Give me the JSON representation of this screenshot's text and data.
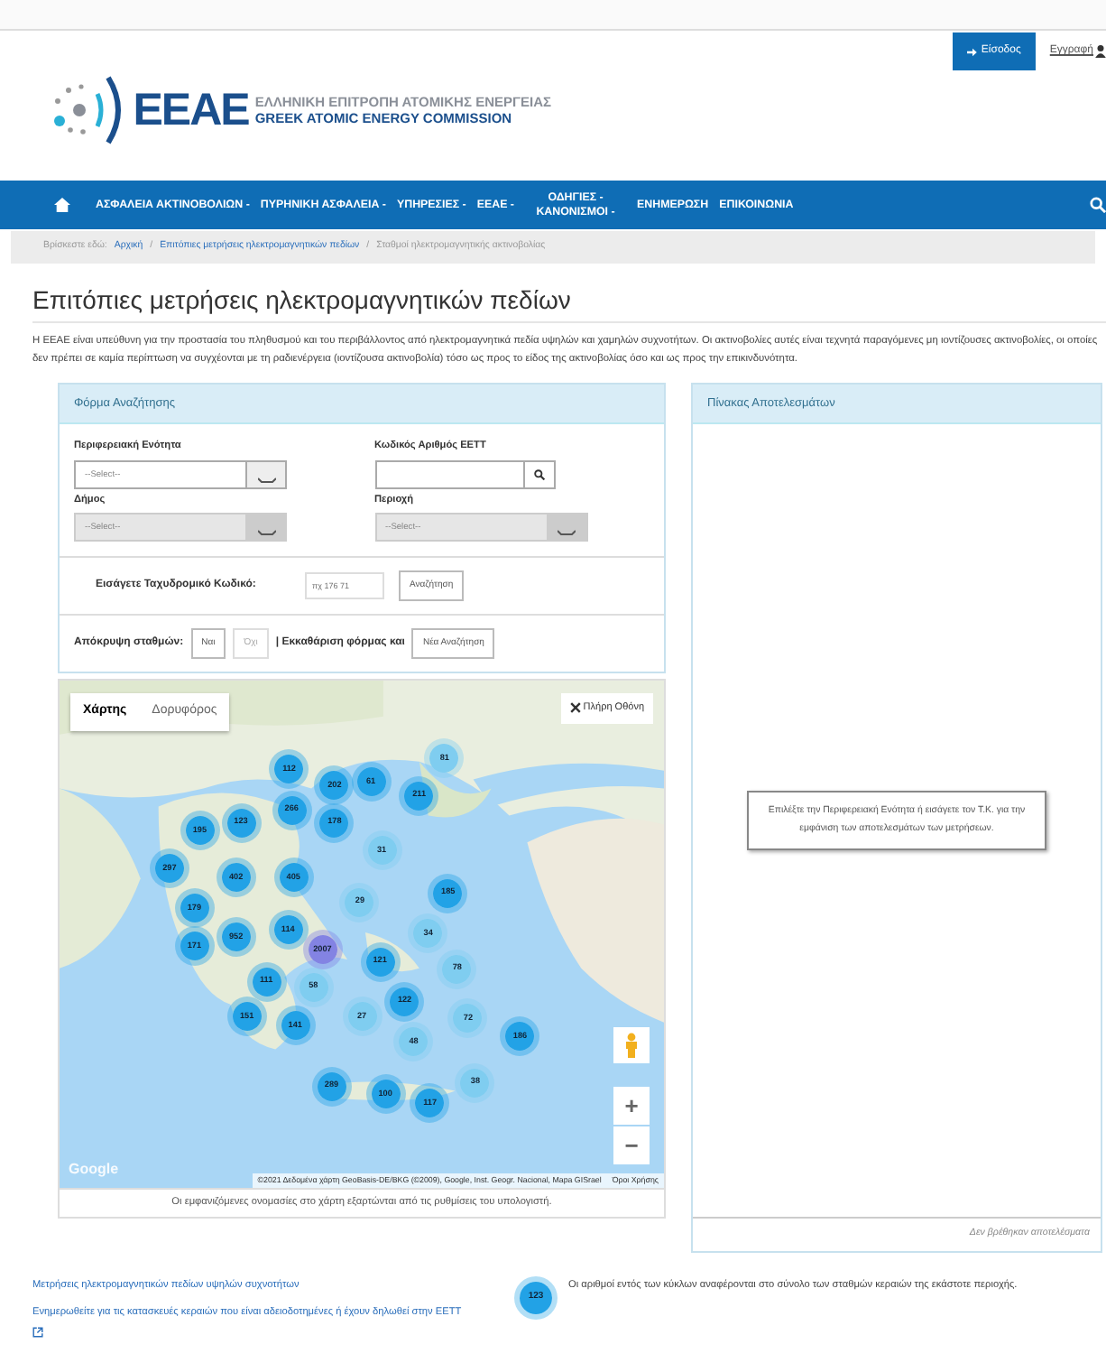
{
  "header": {
    "logo_mark": "EEAE",
    "logo_line_1": "ΕΛΛΗΝΙΚΗ ΕΠΙΤΡΟΠΗ ΑΤΟΜΙΚΗΣ ΕΝΕΡΓΕΙΑΣ",
    "logo_line_2": "GREEK ATOMIC ENERGY COMMISSION",
    "login_button": "Είσοδος",
    "register_link": "Εγγραφή"
  },
  "nav": {
    "items": [
      {
        "label": "ΑΣΦΑΛΕΙΑ ΑΚΤΙΝΟΒΟΛΙΩΝ -"
      },
      {
        "label": "ΠΥΡΗΝΙΚΗ ΑΣΦΑΛΕΙΑ -"
      },
      {
        "label": "ΥΠΗΡΕΣΙΕΣ -"
      },
      {
        "label": "ΕΕΑΕ -"
      },
      {
        "label": "ΟΔΗΓΙΕΣ - ΚΑΝΟΝΙΣΜΟΙ -"
      },
      {
        "label": "ΕΝΗΜΕΡΩΣΗ"
      },
      {
        "label": "ΕΠΙΚΟΙΝΩΝΙΑ"
      }
    ]
  },
  "breadcrumb": {
    "prefix": "Βρίσκεστε εδώ:",
    "separator": "/",
    "items": [
      {
        "label": "Αρχική",
        "kind": "link"
      },
      {
        "label": "Επιτόπιες μετρήσεις ηλεκτρομαγνητικών πεδίων",
        "kind": "link"
      },
      {
        "label": "Σταθμοί ηλεκτρομαγνητικής ακτινοβολίας",
        "kind": "current"
      }
    ]
  },
  "title": "Επιτόπιες μετρήσεις ηλεκτρομαγνητικών πεδίων",
  "intro": "Η ΕΕΑΕ είναι υπεύθυνη για την προστασία του πληθυσμού και του περιβάλλοντος από ηλεκτρομαγνητικά πεδία υψηλών και χαμηλών συχνοτήτων. Οι ακτινοβολίες αυτές είναι τεχνητά παραγόμενες μη ιοντίζουσες ακτινοβολίες, οι οποίες δεν πρέπει σε καμία περίπτωση να συγχέονται με τη ραδιενέργεια (ιοντίζουσα ακτινοβολία) τόσο ως προς το είδος της ακτινοβολίας όσο και ως προς την επικινδυνότητα.",
  "search_form": {
    "title": "Φόρμα Αναζήτησης",
    "fields": [
      {
        "label": "Περιφερειακή Ενότητα",
        "kind": "select",
        "value": "--Select--",
        "disabled": false
      },
      {
        "label": "Κωδικός Αριθμός ΕΕΤΤ",
        "kind": "search"
      },
      {
        "label": "Δήμος",
        "kind": "select",
        "value": "--Select--",
        "disabled": true
      },
      {
        "label": "Περιοχή",
        "kind": "select",
        "value": "--Select--",
        "disabled": true
      }
    ],
    "postcode": {
      "label": "Εισάγετε Ταχυδρομικό Κωδικό:",
      "placeholder": "πχ 176 71",
      "button": "Αναζήτηση"
    },
    "hide_stations": {
      "label": "Απόκρυψη σταθμών:",
      "options": [
        {
          "label": "Ναι",
          "disabled": false
        },
        {
          "label": "Όχι",
          "disabled": true
        }
      ]
    },
    "reset": {
      "label": "| Εκκαθάριση φόρμας και",
      "button": "Νέα Αναζήτηση"
    }
  },
  "map": {
    "map_types": [
      {
        "label": "Χάρτης",
        "selected": true
      },
      {
        "label": "Δορυφόρος",
        "selected": false
      }
    ],
    "fullscreen_button": "Πλήρη Οθόνη",
    "clusters": [
      {
        "count": "112",
        "color": "#22a2e6"
      },
      {
        "count": "202",
        "color": "#22a2e6"
      },
      {
        "count": "61",
        "color": "#22a2e6"
      },
      {
        "count": "81",
        "color": "#7fcdf0"
      },
      {
        "count": "211",
        "color": "#22a2e6"
      },
      {
        "count": "266",
        "color": "#22a2e6"
      },
      {
        "count": "178",
        "color": "#22a2e6"
      },
      {
        "count": "123",
        "color": "#22a2e6"
      },
      {
        "count": "195",
        "color": "#22a2e6"
      },
      {
        "count": "31",
        "color": "#7fcdf0"
      },
      {
        "count": "297",
        "color": "#22a2e6"
      },
      {
        "count": "402",
        "color": "#22a2e6"
      },
      {
        "count": "405",
        "color": "#22a2e6"
      },
      {
        "count": "185",
        "color": "#22a2e6"
      },
      {
        "count": "29",
        "color": "#7fcdf0"
      },
      {
        "count": "179",
        "color": "#22a2e6"
      },
      {
        "count": "114",
        "color": "#22a2e6"
      },
      {
        "count": "952",
        "color": "#22a2e6"
      },
      {
        "count": "34",
        "color": "#7fcdf0"
      },
      {
        "count": "171",
        "color": "#22a2e6"
      },
      {
        "count": "2007",
        "color": "#8383e3"
      },
      {
        "count": "121",
        "color": "#22a2e6"
      },
      {
        "count": "78",
        "color": "#7fcdf0"
      },
      {
        "count": "111",
        "color": "#22a2e6"
      },
      {
        "count": "58",
        "color": "#7fcdf0"
      },
      {
        "count": "122",
        "color": "#22a2e6"
      },
      {
        "count": "151",
        "color": "#22a2e6"
      },
      {
        "count": "141",
        "color": "#22a2e6"
      },
      {
        "count": "27",
        "color": "#7fcdf0"
      },
      {
        "count": "72",
        "color": "#7fcdf0"
      },
      {
        "count": "48",
        "color": "#7fcdf0"
      },
      {
        "count": "186",
        "color": "#22a2e6"
      },
      {
        "count": "289",
        "color": "#22a2e6"
      },
      {
        "count": "100",
        "color": "#22a2e6"
      },
      {
        "count": "117",
        "color": "#22a2e6"
      },
      {
        "count": "38",
        "color": "#7fcdf0"
      }
    ],
    "zoom_in": "+",
    "zoom_out": "−",
    "google_logo": "Google",
    "attribution": "©2021 Δεδομένα χάρτη GeoBasis-DE/BKG (©2009), Google, Inst. Geogr. Nacional, Mapa GISrael",
    "terms_link": "Όροι Χρήσης",
    "caption": "Οι εμφανιζόμενες ονομασίες στο χάρτη εξαρτώνται από τις ρυθμίσεις του υπολογιστή."
  },
  "results": {
    "title": "Πίνακας Αποτελεσμάτων",
    "message": "Επιλέξτε την Περιφερειακή Ενότητα ή εισάγετε τον Τ.Κ. για την εμφάνιση των αποτελεσμάτων των μετρήσεων.",
    "footer": "Δεν βρέθηκαν αποτελέσματα"
  },
  "footer_links": [
    {
      "label": "Μετρήσεις ηλεκτρομαγνητικών πεδίων υψηλών συχνοτήτων",
      "external": false
    },
    {
      "label": "Ενημερωθείτε για τις κατασκευές κεραιών που είναι αδειοδοτημένες ή έχουν δηλωθεί στην ΕΕΤΤ",
      "external": true
    }
  ],
  "legend": {
    "sample_count": "123",
    "text": "Οι αριθμοί εντός των κύκλων αναφέρονται στο σύνολο των σταθμών κεραιών της εκάστοτε περιοχής."
  }
}
